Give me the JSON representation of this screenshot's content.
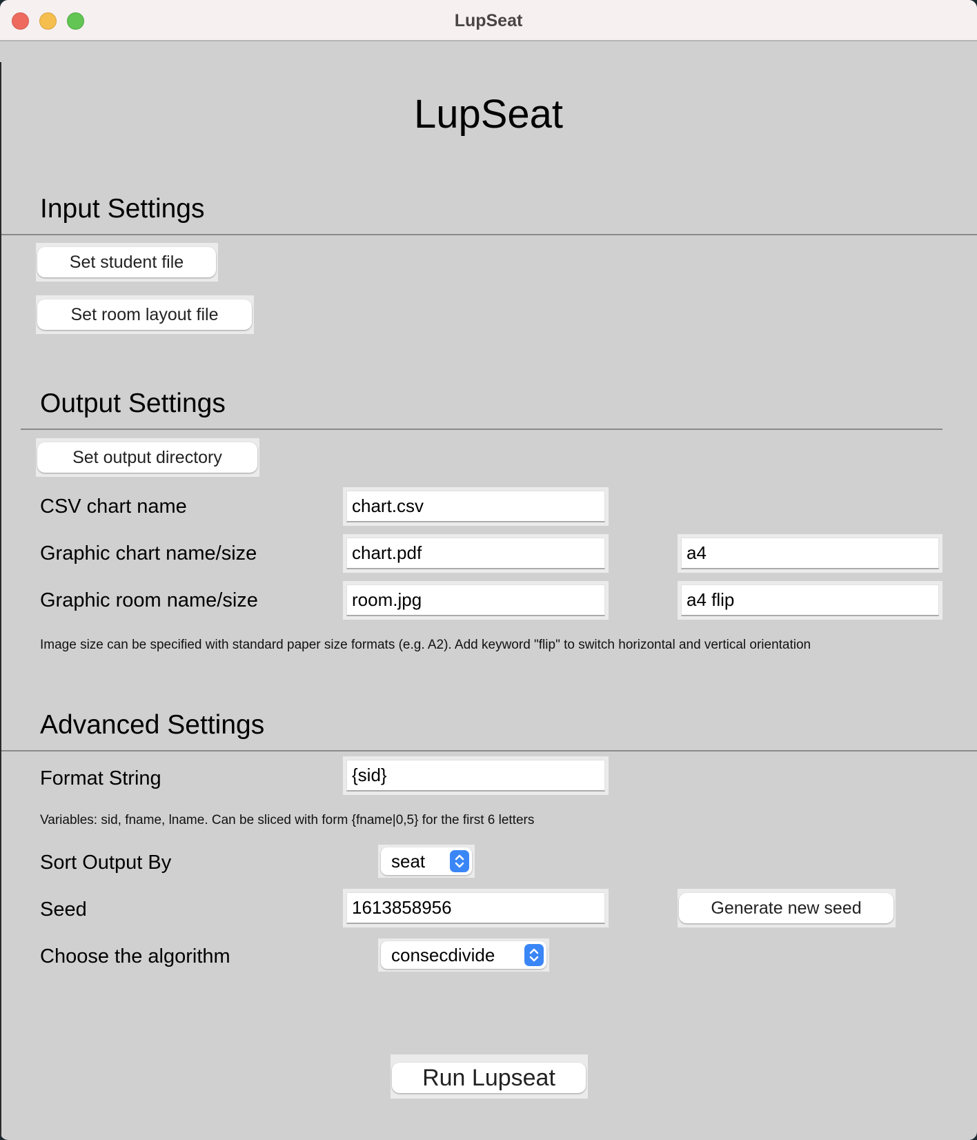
{
  "window": {
    "title": "LupSeat",
    "controls": [
      "close",
      "minimize",
      "maximize"
    ]
  },
  "app_title": "LupSeat",
  "input_settings": {
    "heading": "Input Settings",
    "student_file_button": "Set student file",
    "room_layout_button": "Set room layout file"
  },
  "output_settings": {
    "heading": "Output Settings",
    "output_dir_button": "Set output directory",
    "csv_label": "CSV chart name",
    "csv_value": "chart.csv",
    "graphic_chart_label": "Graphic chart name/size",
    "graphic_chart_name": "chart.pdf",
    "graphic_chart_size": "a4",
    "graphic_room_label": "Graphic room name/size",
    "graphic_room_name": "room.jpg",
    "graphic_room_size": "a4 flip",
    "help_text": "Image size can be specified with standard paper size formats (e.g. A2). Add keyword \"flip\" to switch horizontal and vertical orientation"
  },
  "advanced_settings": {
    "heading": "Advanced Settings",
    "format_label": "Format String",
    "format_value": "{sid}",
    "format_help": "Variables: sid, fname, lname. Can be sliced with form {fname|0,5} for the first 6 letters",
    "sort_label": "Sort Output By",
    "sort_value": "seat",
    "seed_label": "Seed",
    "seed_value": "1613858956",
    "generate_seed_button": "Generate new seed",
    "algorithm_label": "Choose the algorithm",
    "algorithm_value": "consecdivide"
  },
  "run_button": "Run Lupseat",
  "colors": {
    "background": "#d0d0d0",
    "stepper_accent": "#3a86f7",
    "close": "#ee6a5f",
    "minimize": "#f5be4f",
    "maximize": "#62c554"
  }
}
